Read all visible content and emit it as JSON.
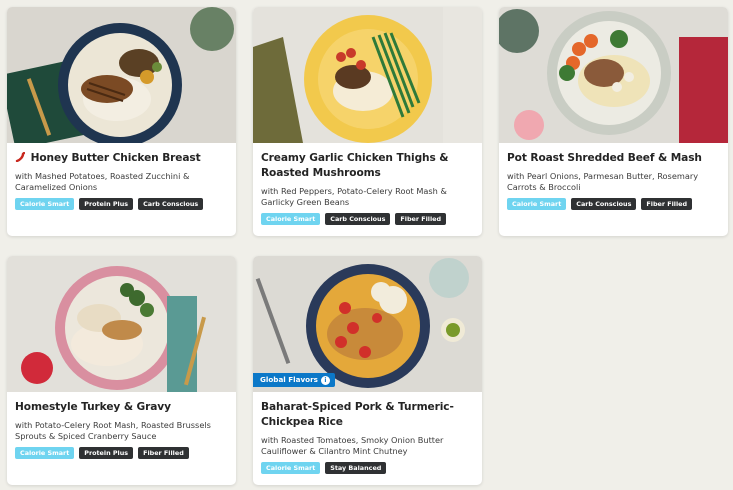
{
  "cards": [
    {
      "title": "Honey Butter Chicken Breast",
      "subtitle": "with Mashed Potatoes, Roasted Zucchini & Caramelized Onions",
      "spicy_icon": "chili-pepper-icon",
      "tags": [
        "Calorie Smart",
        "Protein Plus",
        "Carb Conscious"
      ]
    },
    {
      "title": "Creamy Garlic Chicken Thighs & Roasted Mushrooms",
      "subtitle": "with Red Peppers, Potato-Celery Root Mash & Garlicky Green Beans",
      "tags": [
        "Calorie Smart",
        "Carb Conscious",
        "Fiber Filled"
      ]
    },
    {
      "title": "Pot Roast Shredded Beef & Mash",
      "subtitle": "with Pearl Onions, Parmesan Butter, Rosemary Carrots & Broccoli",
      "tags": [
        "Calorie Smart",
        "Carb Conscious",
        "Fiber Filled"
      ]
    },
    {
      "title": "Homestyle Turkey & Gravy",
      "subtitle": "with Potato-Celery Root Mash, Roasted Brussels Sprouts & Spiced Cranberry Sauce",
      "tags": [
        "Calorie Smart",
        "Protein Plus",
        "Fiber Filled"
      ]
    },
    {
      "title": "Baharat-Spiced Pork & Turmeric-Chickpea Rice",
      "subtitle": "with Roasted Tomatoes, Smoky Onion Butter Cauliflower & Cilantro Mint Chutney",
      "badge": "Global Flavors",
      "badge_icon": "info-icon",
      "tags": [
        "Calorie Smart",
        "Stay Balanced"
      ]
    }
  ],
  "colors": {
    "calorie_smart_tag": "#6fd4f0",
    "dark_tag": "#2f3133",
    "badge": "#0b78c8",
    "background": "#f0efe9"
  }
}
